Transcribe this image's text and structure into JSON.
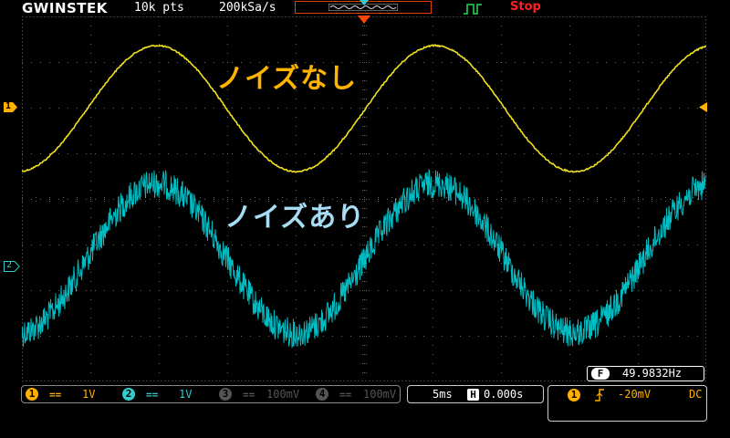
{
  "header": {
    "brand": "GWINSTEK",
    "record_length": "10k pts",
    "sample_rate": "200kSa/s",
    "run_status": "Stop"
  },
  "waveform_labels": {
    "ch1": "ノイズなし",
    "ch2": "ノイズあり"
  },
  "channel_markers": {
    "ch1": "1",
    "ch2": "2"
  },
  "frequency_counter": {
    "badge": "F",
    "value": "49.9832Hz"
  },
  "channels": [
    {
      "num": "1",
      "coupling": "==",
      "scale": "1V",
      "color": "#ffb000",
      "active": true
    },
    {
      "num": "2",
      "coupling": "==",
      "scale": "1V",
      "color": "#33cccc",
      "active": true
    },
    {
      "num": "3",
      "coupling": "==",
      "scale": "100mV",
      "color": "#555555",
      "active": false
    },
    {
      "num": "4",
      "coupling": "==",
      "scale": "100mV",
      "color": "#555555",
      "active": false
    }
  ],
  "timebase": {
    "scale": "5ms",
    "position_badge": "H",
    "position": "0.000s"
  },
  "trigger": {
    "source": "1",
    "slope": "rising-edge-icon",
    "level": "-20mV",
    "coupling": "DC"
  },
  "colors": {
    "ch1_trace": "#f0e020",
    "ch2_trace": "#00d0d8",
    "label_ch1": "#ffb400",
    "label_ch2": "#a6dcf4",
    "status_stop": "#ff2020",
    "memory_bar": "#e04000",
    "trigger_marker": "#ff4400"
  }
}
